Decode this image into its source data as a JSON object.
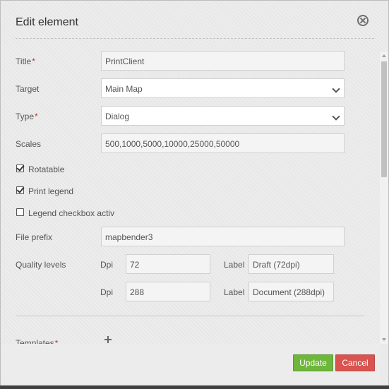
{
  "dialog": {
    "title": "Edit element",
    "close_icon": "close-circle-icon"
  },
  "form": {
    "title": {
      "label": "Title",
      "required_mark": "*",
      "value": "PrintClient"
    },
    "target": {
      "label": "Target",
      "value": "Main Map"
    },
    "type": {
      "label": "Type",
      "required_mark": "*",
      "value": "Dialog"
    },
    "scales": {
      "label": "Scales",
      "value": "500,1000,5000,10000,25000,50000"
    },
    "rotatable": {
      "label": "Rotatable",
      "checked": true
    },
    "print_legend": {
      "label": "Print legend",
      "checked": true
    },
    "legend_checkbox": {
      "label": "Legend checkbox activ",
      "checked": false
    },
    "file_prefix": {
      "label": "File prefix",
      "value": "mapbender3"
    },
    "quality_levels": {
      "label": "Quality levels",
      "rows": [
        {
          "dpi_label": "Dpi",
          "dpi": "72",
          "label_label": "Label",
          "label": "Draft (72dpi)"
        },
        {
          "dpi_label": "Dpi",
          "dpi": "288",
          "label_label": "Label",
          "label": "Document (288dpi)"
        }
      ]
    },
    "templates": {
      "label": "Templates",
      "required_mark": "*",
      "add_icon": "plus-icon"
    }
  },
  "buttons": {
    "update": "Update",
    "cancel": "Cancel"
  },
  "colors": {
    "update": "#6fb63c",
    "cancel": "#d9534f",
    "required": "#c0392b"
  }
}
